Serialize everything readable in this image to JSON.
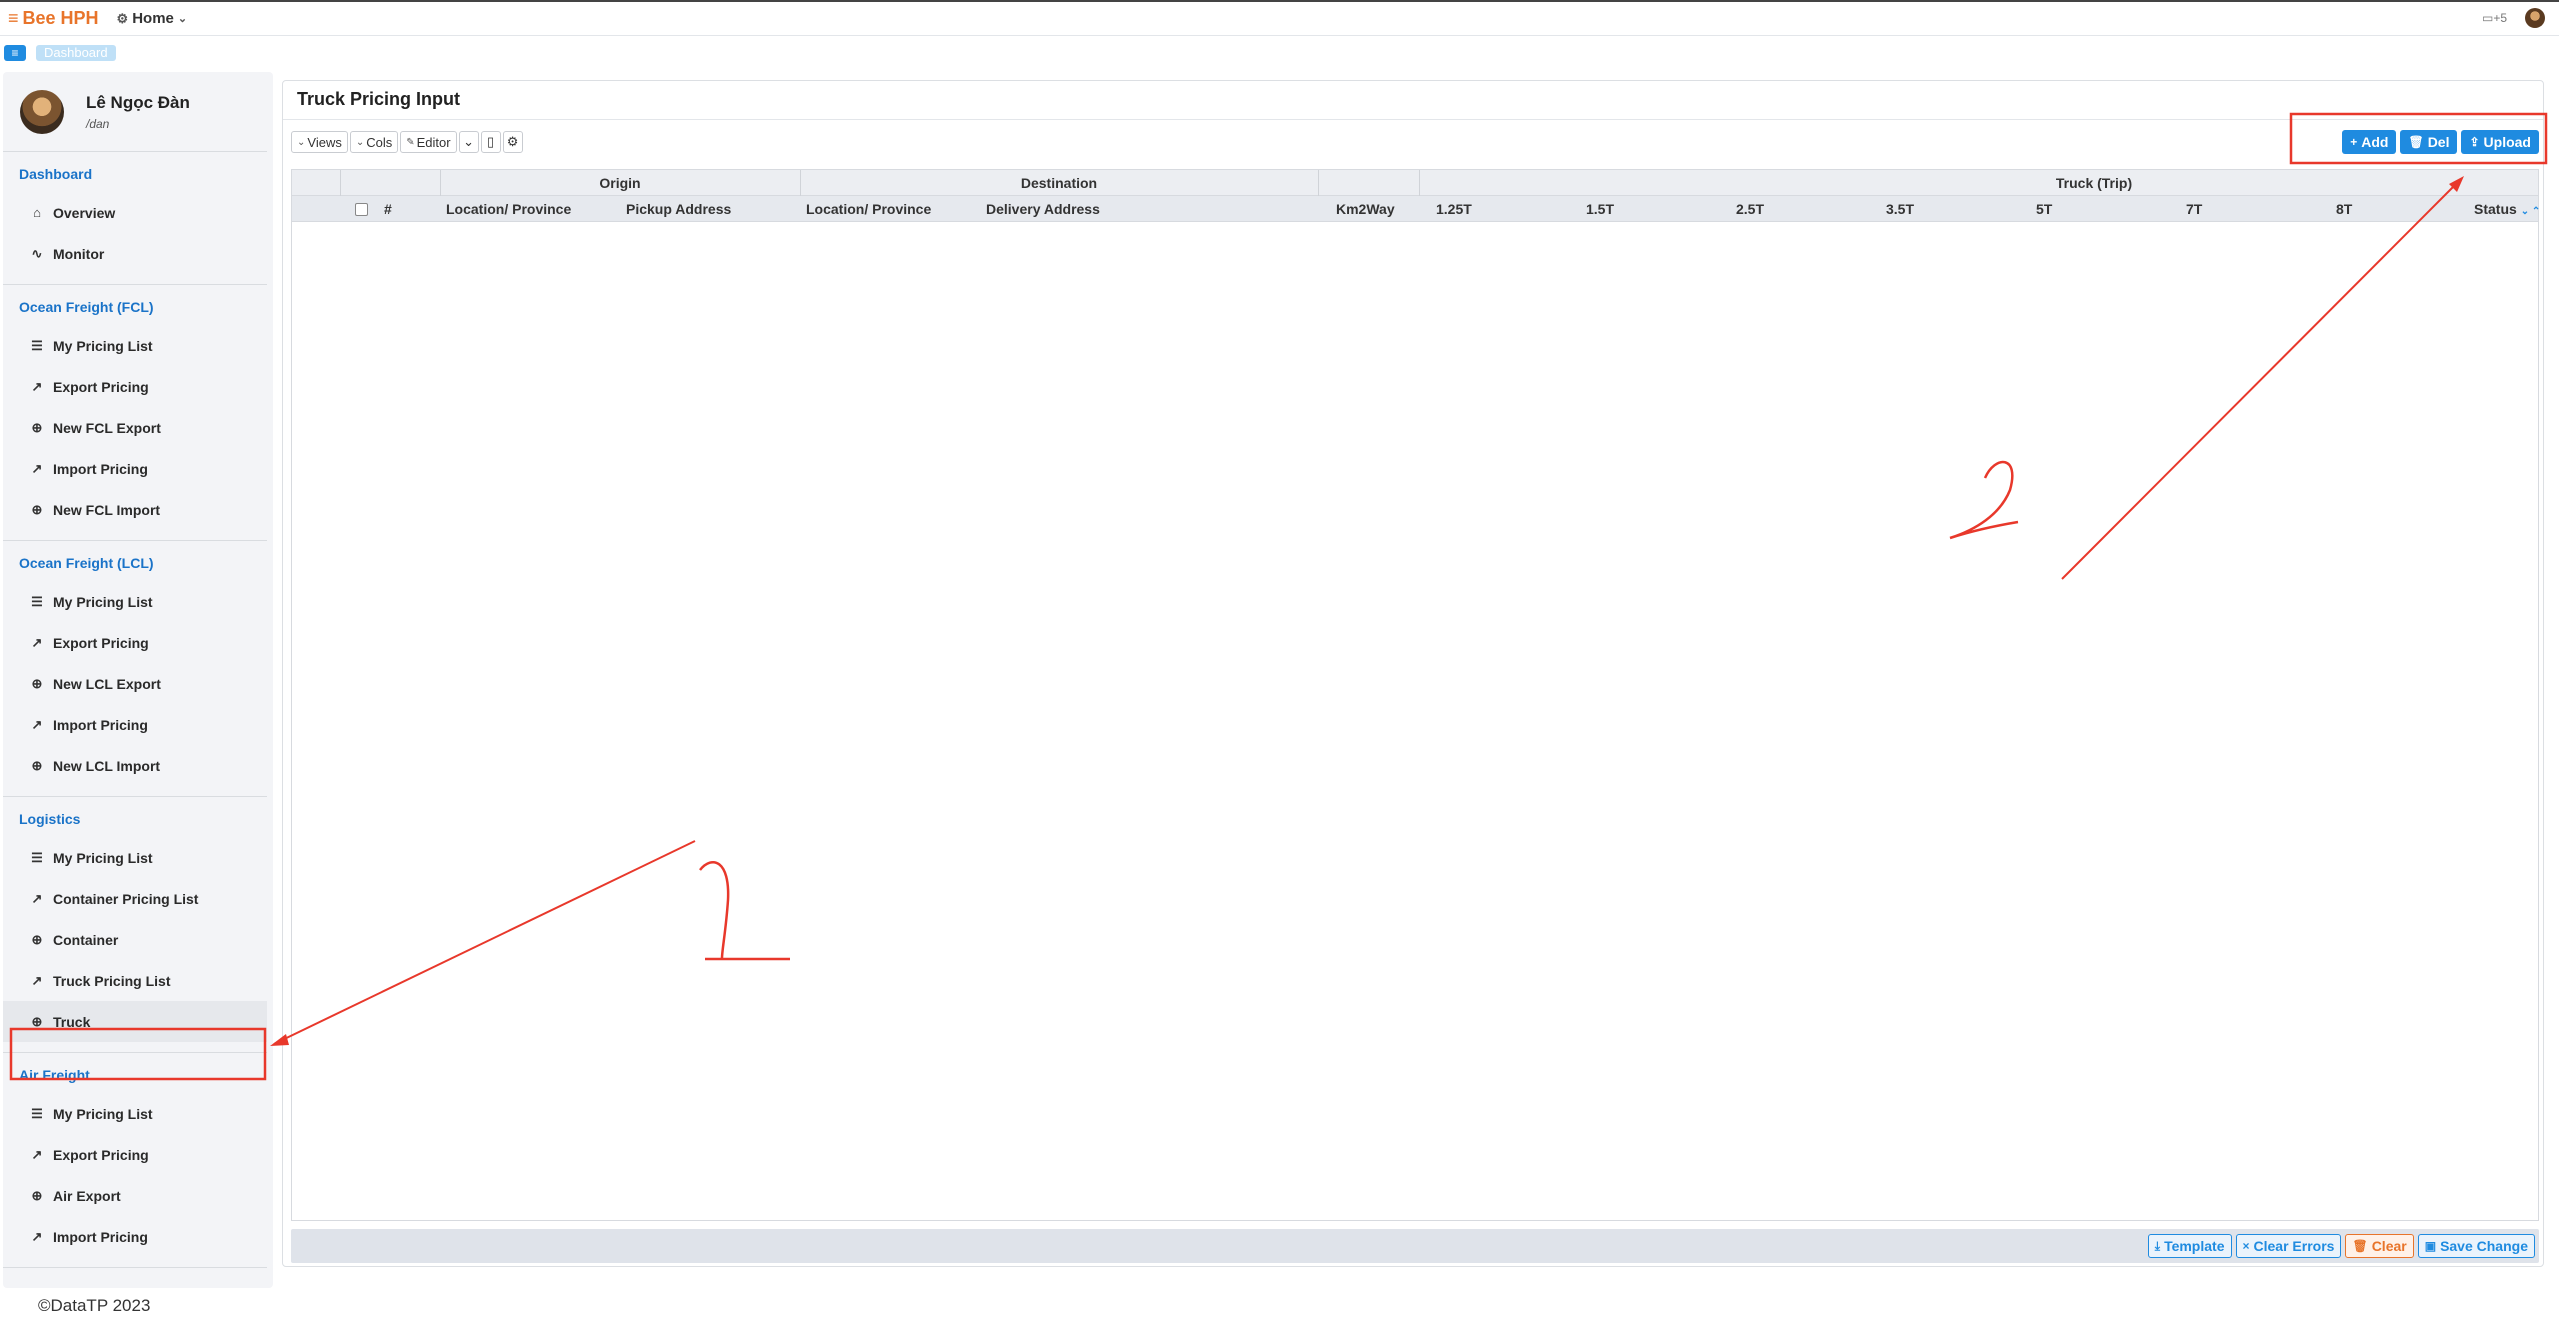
{
  "topbar": {
    "brand": "Bee HPH",
    "home_label": "Home",
    "notifications": "+5"
  },
  "subbar": {
    "menu_icon": "menu-icon",
    "breadcrumb": "Dashboard"
  },
  "profile": {
    "name": "Lê Ngọc Đàn",
    "handle": "/dan"
  },
  "sidebar": {
    "sections": [
      {
        "title": "Dashboard",
        "items": [
          {
            "label": "Overview",
            "icon": "home-icon"
          },
          {
            "label": "Monitor",
            "icon": "activity-icon"
          }
        ]
      },
      {
        "title": "Ocean Freight (FCL)",
        "items": [
          {
            "label": "My Pricing List",
            "icon": "list-icon"
          },
          {
            "label": "Export Pricing",
            "icon": "arrow-up-right-icon"
          },
          {
            "label": "New FCL Export",
            "icon": "plus-circle-icon"
          },
          {
            "label": "Import Pricing",
            "icon": "arrow-up-right-icon"
          },
          {
            "label": "New FCL Import",
            "icon": "plus-circle-icon"
          }
        ]
      },
      {
        "title": "Ocean Freight (LCL)",
        "items": [
          {
            "label": "My Pricing List",
            "icon": "list-icon"
          },
          {
            "label": "Export Pricing",
            "icon": "arrow-up-right-icon"
          },
          {
            "label": "New LCL Export",
            "icon": "plus-circle-icon"
          },
          {
            "label": "Import Pricing",
            "icon": "arrow-up-right-icon"
          },
          {
            "label": "New LCL Import",
            "icon": "plus-circle-icon"
          }
        ]
      },
      {
        "title": "Logistics",
        "items": [
          {
            "label": "My Pricing List",
            "icon": "list-icon"
          },
          {
            "label": "Container Pricing List",
            "icon": "arrow-up-right-icon"
          },
          {
            "label": "Container",
            "icon": "plus-circle-icon"
          },
          {
            "label": "Truck Pricing List",
            "icon": "arrow-up-right-icon"
          },
          {
            "label": "Truck",
            "icon": "plus-circle-icon",
            "active": true
          }
        ]
      },
      {
        "title": "Air Freight",
        "items": [
          {
            "label": "My Pricing List",
            "icon": "list-icon"
          },
          {
            "label": "Export Pricing",
            "icon": "arrow-up-right-icon"
          },
          {
            "label": "Air Export",
            "icon": "plus-circle-icon"
          },
          {
            "label": "Import Pricing",
            "icon": "arrow-up-right-icon"
          }
        ]
      }
    ],
    "footer": "©DataTP 2023"
  },
  "panel": {
    "title": "Truck Pricing Input",
    "toolbar": {
      "views": "Views",
      "cols": "Cols",
      "editor": "Editor"
    },
    "actions": {
      "add": "Add",
      "del": "Del",
      "upload": "Upload"
    },
    "grid": {
      "group_headers": {
        "origin": "Origin",
        "destination": "Destination",
        "truck": "Truck (Trip)"
      },
      "columns": {
        "index": "#",
        "origin_location": "Location/ Province",
        "pickup_address": "Pickup Address",
        "dest_location": "Location/ Province",
        "delivery_address": "Delivery Address",
        "km2way": "Km2Way",
        "t125": "1.25T",
        "t15": "1.5T",
        "t25": "2.5T",
        "t35": "3.5T",
        "t5": "5T",
        "t7": "7T",
        "t8": "8T",
        "status": "Status"
      }
    },
    "bottom": {
      "template": "Template",
      "clear_errors": "Clear Errors",
      "clear": "Clear",
      "save": "Save Change"
    }
  },
  "annotations": {
    "label_1": "1",
    "label_2": "2",
    "color": "#e8382b"
  }
}
